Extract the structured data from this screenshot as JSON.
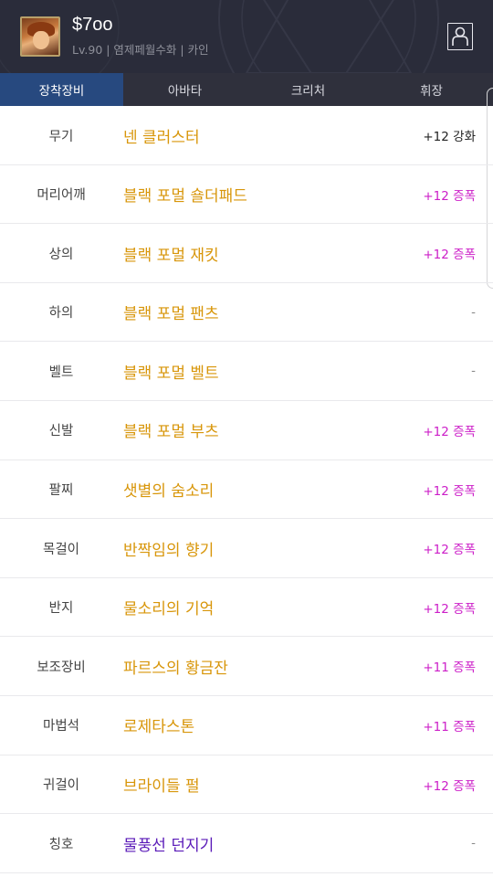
{
  "header": {
    "character_name": "$7oo",
    "character_meta": "Lv.90 | 염제페월수화 | 카인",
    "profile_icon": "person-icon"
  },
  "tabs": [
    {
      "label": "장착장비",
      "active": true
    },
    {
      "label": "아바타",
      "active": false
    },
    {
      "label": "크리처",
      "active": false
    },
    {
      "label": "휘장",
      "active": false
    }
  ],
  "equipment": [
    {
      "slot": "무기",
      "item": "넨 클러스터",
      "stat": "+12 강화",
      "stat_type": "black",
      "item_color": "#d8960a"
    },
    {
      "slot": "머리어깨",
      "item": "블랙 포멀 숄더패드",
      "stat": "+12 증폭",
      "stat_type": "magenta",
      "item_color": "#d8960a"
    },
    {
      "slot": "상의",
      "item": "블랙 포멀 재킷",
      "stat": "+12 증폭",
      "stat_type": "magenta",
      "item_color": "#d8960a"
    },
    {
      "slot": "하의",
      "item": "블랙 포멀 팬츠",
      "stat": "-",
      "stat_type": "dash",
      "item_color": "#d8960a"
    },
    {
      "slot": "벨트",
      "item": "블랙 포멀 벨트",
      "stat": "-",
      "stat_type": "dash",
      "item_color": "#d8960a"
    },
    {
      "slot": "신발",
      "item": "블랙 포멀 부츠",
      "stat": "+12 증폭",
      "stat_type": "magenta",
      "item_color": "#d8960a"
    },
    {
      "slot": "팔찌",
      "item": "샛별의 숨소리",
      "stat": "+12 증폭",
      "stat_type": "magenta",
      "item_color": "#d8960a"
    },
    {
      "slot": "목걸이",
      "item": "반짝임의 향기",
      "stat": "+12 증폭",
      "stat_type": "magenta",
      "item_color": "#d8960a"
    },
    {
      "slot": "반지",
      "item": "물소리의 기억",
      "stat": "+12 증폭",
      "stat_type": "magenta",
      "item_color": "#d8960a"
    },
    {
      "slot": "보조장비",
      "item": "파르스의 황금잔",
      "stat": "+11 증폭",
      "stat_type": "magenta",
      "item_color": "#d8960a"
    },
    {
      "slot": "마법석",
      "item": "로제타스톤",
      "stat": "+11 증폭",
      "stat_type": "magenta",
      "item_color": "#d8960a"
    },
    {
      "slot": "귀걸이",
      "item": "브라이들 펄",
      "stat": "+12 증폭",
      "stat_type": "magenta",
      "item_color": "#d8960a"
    },
    {
      "slot": "칭호",
      "item": "물풍선 던지기",
      "stat": "-",
      "stat_type": "dash",
      "item_color": "#5a1ab8"
    }
  ],
  "colors": {
    "header_bg": "#2a2c3a",
    "tab_bg": "#2f303c",
    "tab_active_bg": "#27497f",
    "unique_item": "#d8960a",
    "title_item": "#5a1ab8",
    "amplify_stat": "#cc1ec8"
  }
}
